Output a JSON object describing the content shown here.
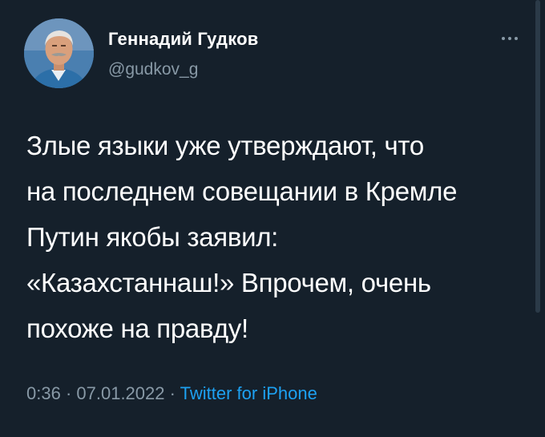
{
  "tweet": {
    "author_name": "Геннадий Гудков",
    "author_handle": "@gudkov_g",
    "text_lines": [
      "Злые языки уже  утверждают, что",
      "на последнем совещании в Кремле",
      "Путин якобы заявил:",
      "«Казахстаннаш!» Впрочем, очень",
      "похоже на правду!"
    ],
    "time": "0:36",
    "separator": " · ",
    "date": "07.01.2022",
    "source": "Twitter for iPhone"
  },
  "icons": {
    "more": "more-options-icon",
    "avatar": "avatar"
  },
  "colors": {
    "background": "#15202b",
    "text": "#ffffff",
    "muted": "#8899a6",
    "link": "#1da1f2"
  }
}
